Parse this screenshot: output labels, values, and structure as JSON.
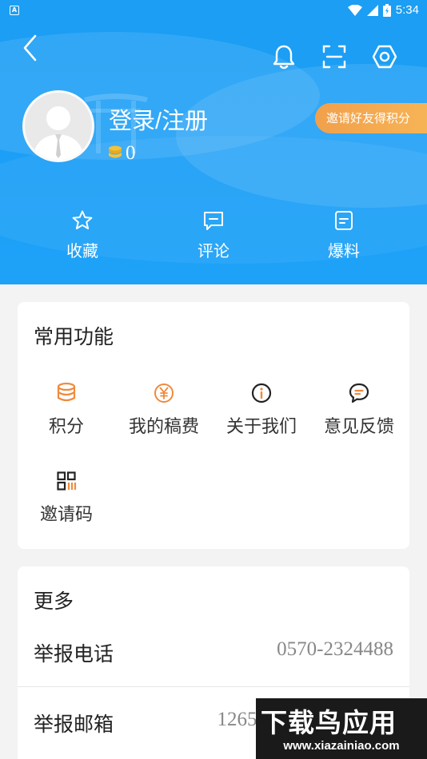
{
  "status_bar": {
    "time": "5:34",
    "app_badge": "A"
  },
  "profile": {
    "login_label": "登录/注册",
    "points": "0",
    "invite_button": "邀请好友得积分"
  },
  "quick_actions": [
    {
      "label": "收藏",
      "icon": "star-icon"
    },
    {
      "label": "评论",
      "icon": "comment-icon"
    },
    {
      "label": "爆料",
      "icon": "report-icon"
    }
  ],
  "common_functions": {
    "title": "常用功能",
    "items": [
      {
        "label": "积分",
        "icon": "coins-icon"
      },
      {
        "label": "我的稿费",
        "icon": "yuan-icon"
      },
      {
        "label": "关于我们",
        "icon": "info-icon"
      },
      {
        "label": "意见反馈",
        "icon": "feedback-icon"
      },
      {
        "label": "邀请码",
        "icon": "qr-code-icon"
      }
    ]
  },
  "more": {
    "title": "更多",
    "rows": [
      {
        "label": "举报电话",
        "value": "0570-2324488"
      },
      {
        "label": "举报邮箱",
        "value": "12659"
      }
    ]
  },
  "watermark": {
    "title": "下载鸟应用",
    "url": "www.xiazainiao.com"
  },
  "colors": {
    "header_blue": "#1c9ff6",
    "accent_orange": "#f08a3c",
    "invite_pill": "#f5ac52"
  }
}
